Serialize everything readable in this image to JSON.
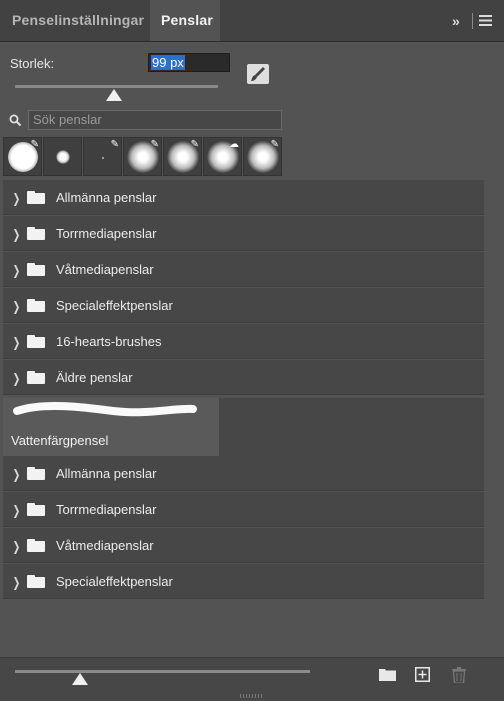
{
  "tabs": [
    {
      "label": "Penselinställningar",
      "active": false
    },
    {
      "label": "Penslar",
      "active": true
    }
  ],
  "header": {
    "collapse_glyph": "»",
    "menu_icon": "hamburger-menu-icon"
  },
  "size": {
    "label": "Storlek:",
    "value": "99 px",
    "slider_fraction": 0.45
  },
  "search": {
    "placeholder": "Sök penslar"
  },
  "preset_tool_glyphs": [
    "✎",
    "",
    "✎",
    "✎",
    "✎",
    "☁",
    "✎"
  ],
  "groups_a": [
    "Allmänna penslar",
    "Torrmediapenslar",
    "Våtmediapenslar",
    "Specialeffektpenslar",
    "16-hearts-brushes",
    "Äldre penslar"
  ],
  "selected_brush": {
    "name": "Vattenfärgpensel"
  },
  "groups_b": [
    "Allmänna penslar",
    "Torrmediapenslar",
    "Våtmediapenslar",
    "Specialeffektpenslar"
  ],
  "footer": {
    "preview_slider_fraction": 0.2
  },
  "colors": {
    "panel": "#535353",
    "row": "#474747",
    "selection": "#2b6fd1"
  }
}
